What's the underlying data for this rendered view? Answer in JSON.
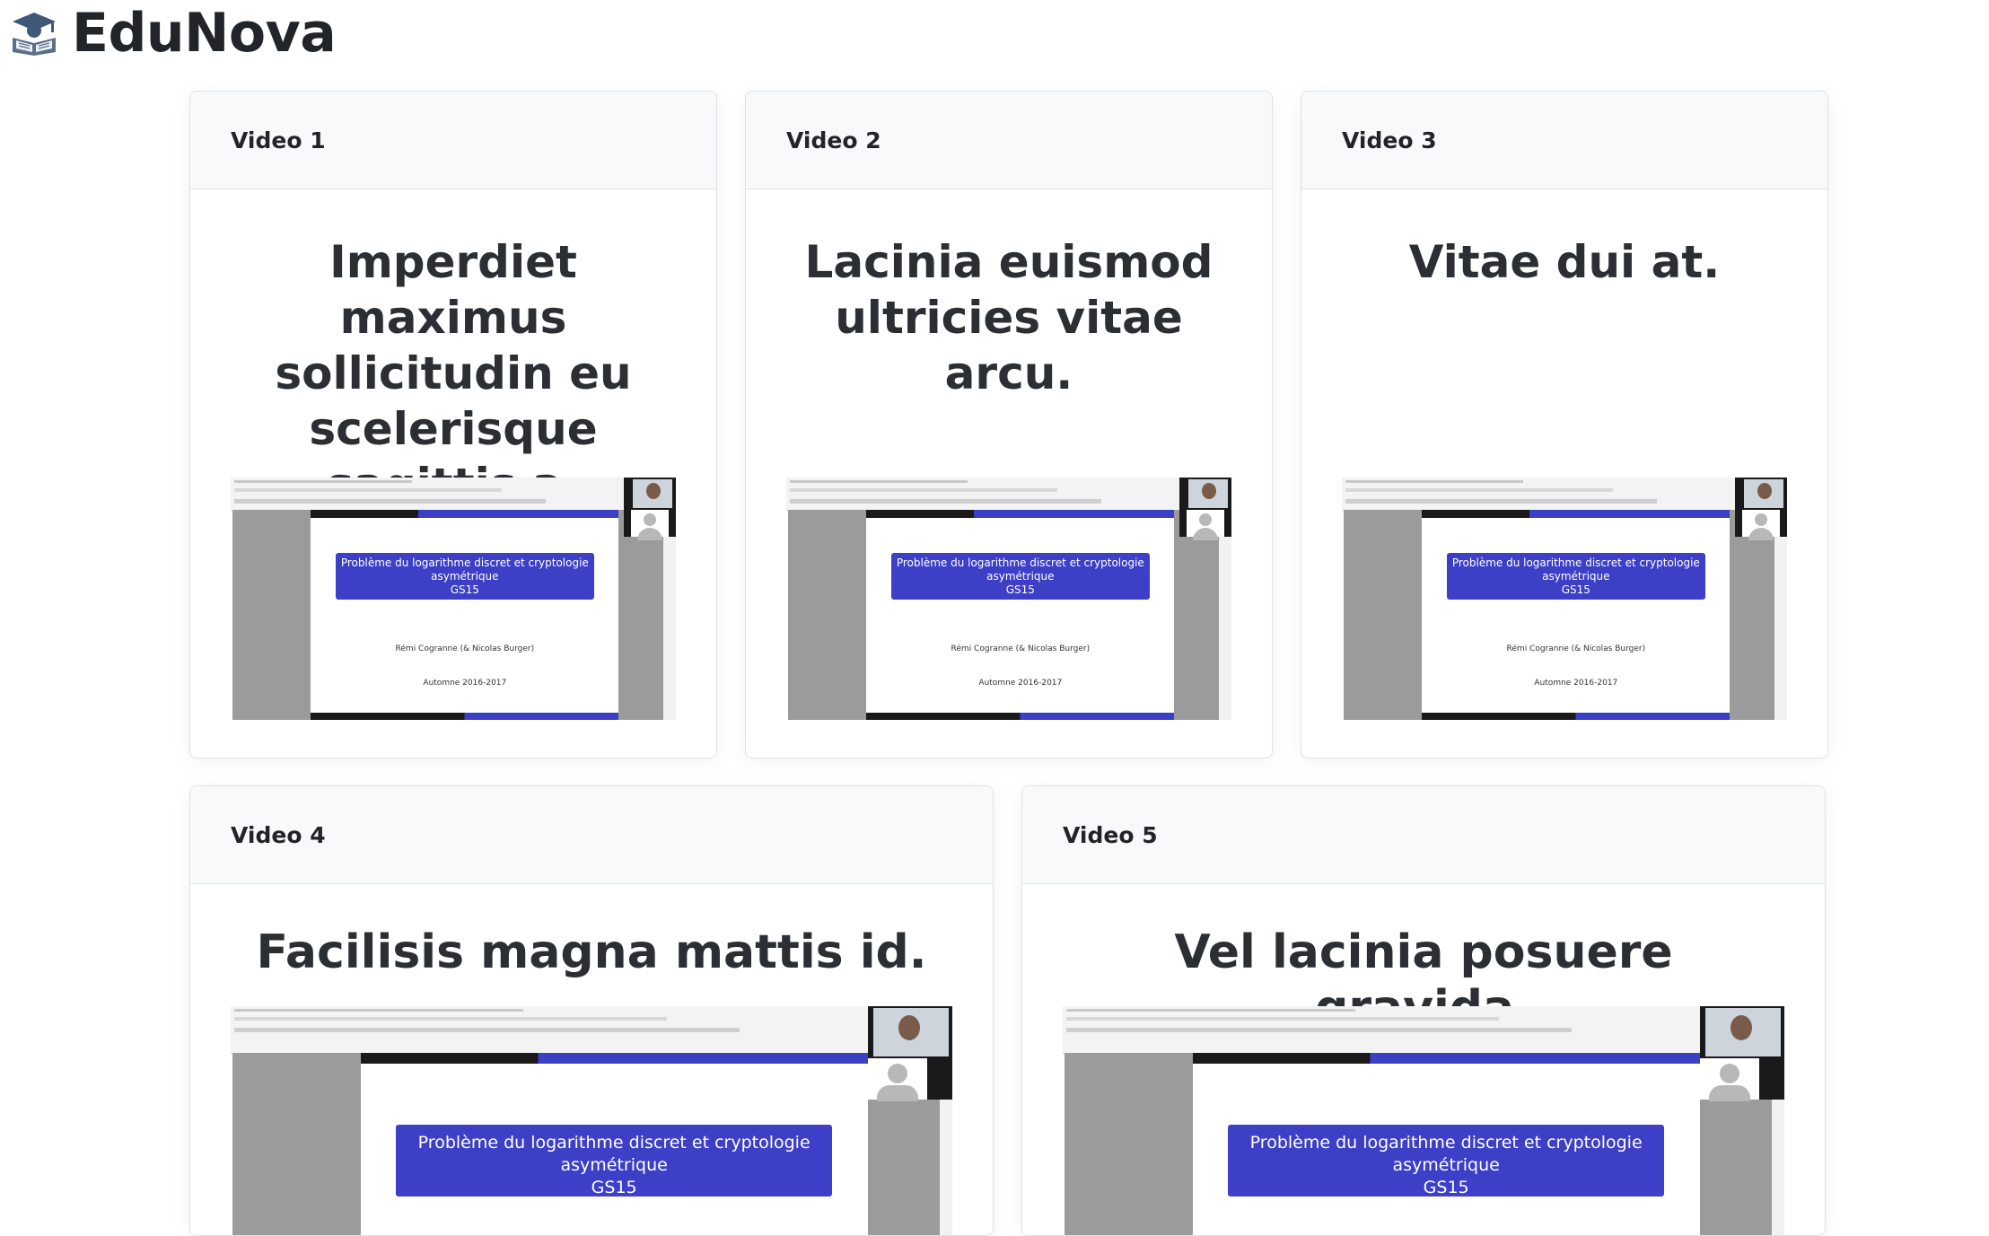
{
  "app": {
    "brand": "EduNova",
    "logo_icon": "reading-student-icon"
  },
  "cards": [
    {
      "header": "Video 1",
      "title": "Imperdiet maximus sollicitudin eu scelerisque sagittis a.",
      "thumbnail": {
        "slide_title": "Problème du logarithme discret et cryptologie asymétrique",
        "slide_code": "GS15",
        "slide_author": "Rémi Cogranne (& Nicolas Burger)",
        "slide_date": "Automne 2016-2017"
      }
    },
    {
      "header": "Video 2",
      "title": "Lacinia euismod ultricies vitae arcu.",
      "thumbnail": {
        "slide_title": "Problème du logarithme discret et cryptologie asymétrique",
        "slide_code": "GS15",
        "slide_author": "Rémi Cogranne (& Nicolas Burger)",
        "slide_date": "Automne 2016-2017"
      }
    },
    {
      "header": "Video 3",
      "title": "Vitae dui at.",
      "thumbnail": {
        "slide_title": "Problème du logarithme discret et cryptologie asymétrique",
        "slide_code": "GS15",
        "slide_author": "Rémi Cogranne (& Nicolas Burger)",
        "slide_date": "Automne 2016-2017"
      }
    },
    {
      "header": "Video 4",
      "title": "Facilisis magna mattis id.",
      "thumbnail": {
        "slide_title": "Problème du logarithme discret et cryptologie asymétrique",
        "slide_code": "GS15"
      }
    },
    {
      "header": "Video 5",
      "title": "Vel lacinia posuere gravida.",
      "thumbnail": {
        "slide_title": "Problème du logarithme discret et cryptologie asymétrique",
        "slide_code": "GS15"
      }
    }
  ]
}
